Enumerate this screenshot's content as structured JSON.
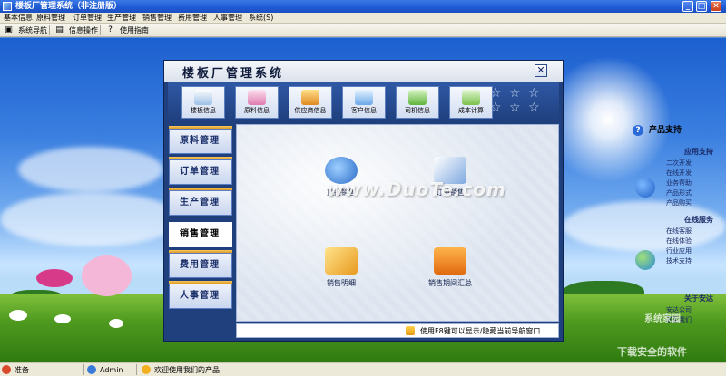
{
  "window": {
    "title": "楼板厂管理系统（非注册版）",
    "buttons": {
      "minimize": "_",
      "maximize": "□",
      "close": "✕"
    }
  },
  "menu": [
    "基本信息",
    "原料管理",
    "订单管理",
    "生产管理",
    "销售管理",
    "费用管理",
    "人事管理",
    "系统(S)"
  ],
  "toolbar": [
    {
      "label": "系统导航",
      "icon": "monitor-icon"
    },
    {
      "label": "信息操作",
      "icon": "document-icon"
    },
    {
      "label": "使用指南",
      "icon": "help-icon"
    }
  ],
  "dialog": {
    "title": "楼板厂管理系统",
    "close": "✕",
    "top_buttons": [
      "楼板信息",
      "原料信息",
      "供应商信息",
      "客户信息",
      "司机信息",
      "成本计算"
    ],
    "nav": [
      "原料管理",
      "订单管理",
      "生产管理",
      "销售管理",
      "费用管理",
      "人事管理"
    ],
    "active_nav": "销售管理",
    "content_items": [
      "直接销售",
      "订单销售",
      "销售明细",
      "销售期间汇总"
    ],
    "watermark": "www.DuoTe.com",
    "hint": "使用F8键可以显示/隐藏当前导航窗口"
  },
  "right_panel": {
    "title": "产品支持",
    "sections": [
      {
        "title": "应用支持",
        "links": [
          "二次开发",
          "在线开发",
          "业务帮助",
          "产品形式",
          "产品购买"
        ]
      },
      {
        "title": "在线服务",
        "links": [
          "在线客服",
          "在线体验",
          "行业应用",
          "技术支持"
        ]
      },
      {
        "title": "关于安达",
        "links": [
          "安达公司",
          "联系我们"
        ]
      }
    ]
  },
  "statusbar": {
    "ready": "准备",
    "user": "Admin",
    "welcome": "欢迎使用我们的产品!"
  },
  "corner_watermark": {
    "line1": "系统家园",
    "line2": "下载安全的软件"
  }
}
